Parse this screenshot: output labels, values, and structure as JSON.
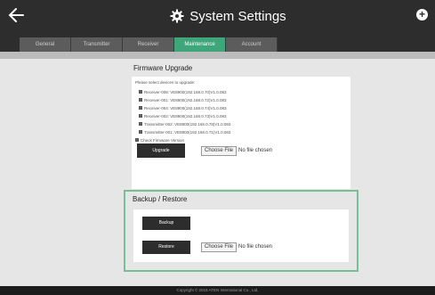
{
  "header": {
    "title": "System Settings",
    "back_icon": "back-arrow-icon",
    "gear_icon": "gear-icon",
    "add_icon": "plus-circle-icon"
  },
  "tabs": [
    {
      "label": "General",
      "active": false
    },
    {
      "label": "Transmitter",
      "active": false
    },
    {
      "label": "Receiver",
      "active": false
    },
    {
      "label": "Maintenance",
      "active": true
    },
    {
      "label": "Account",
      "active": false
    }
  ],
  "firmware": {
    "title": "Firmware Upgrade",
    "prompt": "Please select devices to upgrade:",
    "devices": [
      "Receiver-008: VE8900(192.168.0.70)V1.0.083",
      "Receiver-001: VE8900(192.168.0.72)V1.0.083",
      "Receiver-004: VE8900(192.168.0.74)V1.0.083",
      "Receiver-002: VE8900(192.168.0.73)V1.0.083",
      "Transmitter-002: VE8900(192.168.0.78)V1.0.083",
      "Transmitter-001: VE8900(192.168.0.71)V1.0.083"
    ],
    "check_version_label": "Check Firmware Version",
    "upgrade_label": "Upgrade",
    "choose_file_label": "Choose File",
    "no_file_label": "No file chosen"
  },
  "backup_restore": {
    "title": "Backup / Restore",
    "backup_label": "Backup",
    "restore_label": "Restore",
    "choose_file_label": "Choose File",
    "no_file_label": "No file chosen"
  },
  "footer": {
    "copyright": "Copyright © 2018 ATEN International Co., Ltd."
  },
  "colors": {
    "accent": "#3fa57b",
    "highlight_border": "#78bf95",
    "titlebar": "#2d2d2d"
  }
}
